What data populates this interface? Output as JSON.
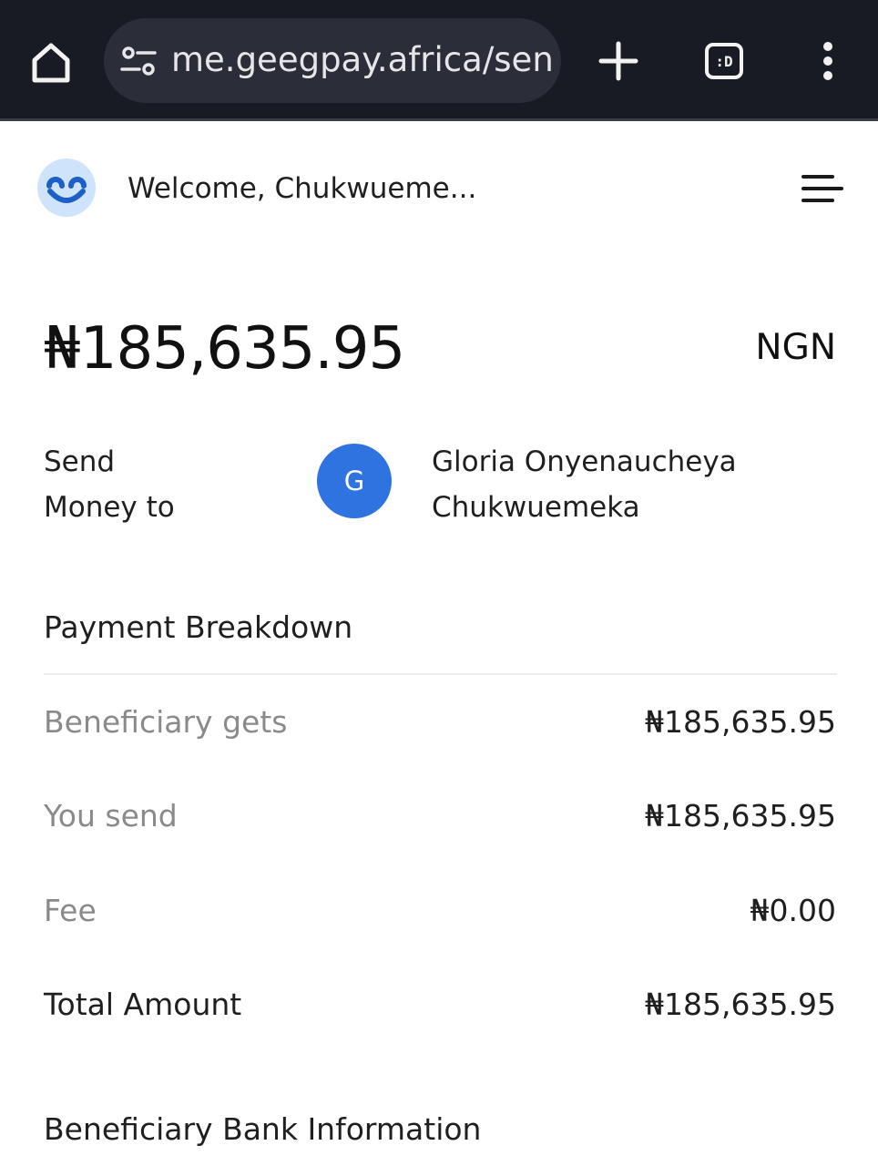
{
  "browser": {
    "url": "me.geegpay.africa/sen",
    "tab_count_label": ":D"
  },
  "header": {
    "welcome": "Welcome, Chukwueme..."
  },
  "balance": {
    "amount": "₦185,635.95",
    "currency": "NGN"
  },
  "send": {
    "label_line1": "Send",
    "label_line2": "Money to",
    "avatar_initial": "G",
    "recipient_line1": "Gloria Onyenaucheya",
    "recipient_line2": "Chukwuemeka"
  },
  "breakdown": {
    "title": "Payment Breakdown",
    "rows": [
      {
        "label": "Beneficiary gets",
        "value": "₦185,635.95"
      },
      {
        "label": "You send",
        "value": "₦185,635.95"
      },
      {
        "label": "Fee",
        "value": "₦0.00"
      },
      {
        "label": "Total Amount",
        "value": "₦185,635.95"
      }
    ]
  },
  "bank_info": {
    "title": "Beneficiary Bank Information"
  },
  "colors": {
    "browser_bg": "#181a24",
    "avatar_blue": "#2f73e0",
    "logo_bg": "#cfe3fb",
    "muted_text": "#8a8a8a"
  }
}
